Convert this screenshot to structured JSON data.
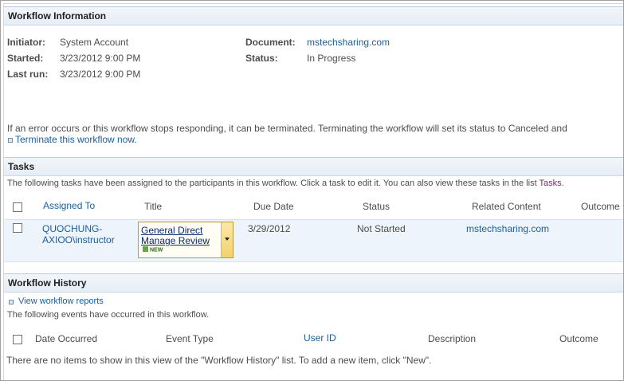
{
  "info": {
    "header": "Workflow Information",
    "initiator_label": "Initiator:",
    "initiator_value": "System Account",
    "started_label": "Started:",
    "started_value": "3/23/2012 9:00 PM",
    "lastrun_label": "Last run:",
    "lastrun_value": "3/23/2012 9:00 PM",
    "document_label": "Document:",
    "document_value": "mstechsharing.com",
    "status_label": "Status:",
    "status_value": "In Progress",
    "error_text": "If an error occurs or this workflow stops responding, it can be terminated. Terminating the workflow will set its status to Canceled and",
    "terminate_link": "Terminate this workflow now."
  },
  "tasks": {
    "header": "Tasks",
    "intro_text": "The following tasks have been assigned to the participants in this workflow. Click a task to edit it. You can also view these tasks in the list",
    "intro_link": "Tasks",
    "intro_end": ".",
    "columns": [
      "Assigned To",
      "Title",
      "Due Date",
      "Status",
      "Related Content",
      "Outcome"
    ],
    "rows": [
      {
        "assigned_line1": "QUOCHUNG-",
        "assigned_line2": "AXIOO\\instructor",
        "title_line1": "General Direct",
        "title_line2": "Manage Review",
        "new_badge": "NEW",
        "due": "3/29/2012",
        "status": "Not Started",
        "related": "mstechsharing.com",
        "outcome": ""
      }
    ]
  },
  "history": {
    "header": "Workflow History",
    "reports_link": "View workflow reports",
    "intro_text": "The following events have occurred in this workflow.",
    "columns": [
      "Date Occurred",
      "Event Type",
      "User ID",
      "Description",
      "Outcome"
    ],
    "empty_text": "There are no items to show in this view of the \"Workflow History\" list. To add a new item, click \"New\"."
  },
  "colors": {
    "link": "#1c5d9a",
    "header_bg": "#e9eff7",
    "row_bg": "#edf4fb",
    "tasks_link": "#7a2a6e"
  }
}
